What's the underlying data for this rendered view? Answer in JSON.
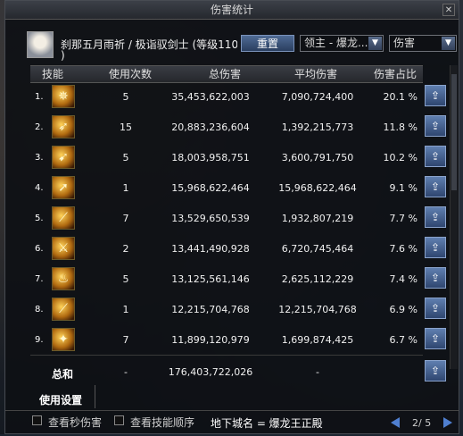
{
  "window": {
    "title": "伤害统计",
    "close_icon": "close-icon"
  },
  "header": {
    "character_name_line1": "刹那五月雨祈 / 极诣驭剑士 (等级110",
    "character_name_line2": ")",
    "reset_button": "重置",
    "target_select": "领主 - 爆龙...",
    "mode_select": "伤害"
  },
  "columns": [
    "技能",
    "使用次数",
    "总伤害",
    "平均伤害",
    "伤害占比"
  ],
  "rows": [
    {
      "index": "1.",
      "uses": "5",
      "total": "35,453,622,003",
      "average": "7,090,724,400",
      "percent": "20.1 %"
    },
    {
      "index": "2.",
      "uses": "15",
      "total": "20,883,236,604",
      "average": "1,392,215,773",
      "percent": "11.8 %"
    },
    {
      "index": "3.",
      "uses": "5",
      "total": "18,003,958,751",
      "average": "3,600,791,750",
      "percent": "10.2 %"
    },
    {
      "index": "4.",
      "uses": "1",
      "total": "15,968,622,464",
      "average": "15,968,622,464",
      "percent": "9.1 %"
    },
    {
      "index": "5.",
      "uses": "7",
      "total": "13,529,650,539",
      "average": "1,932,807,219",
      "percent": "7.7 %"
    },
    {
      "index": "6.",
      "uses": "2",
      "total": "13,441,490,928",
      "average": "6,720,745,464",
      "percent": "7.6 %"
    },
    {
      "index": "7.",
      "uses": "5",
      "total": "13,125,561,146",
      "average": "2,625,112,229",
      "percent": "7.4 %"
    },
    {
      "index": "8.",
      "uses": "1",
      "total": "12,215,704,768",
      "average": "12,215,704,768",
      "percent": "6.9 %"
    },
    {
      "index": "9.",
      "uses": "7",
      "total": "11,899,120,979",
      "average": "1,699,874,425",
      "percent": "6.7 %"
    }
  ],
  "total_row": {
    "label": "总和",
    "uses": "-",
    "total": "176,403,722,026",
    "average": "-"
  },
  "settings": {
    "label": "使用设置"
  },
  "footer": {
    "checkbox1_label": "查看秒伤害",
    "checkbox2_label": "查看技能顺序",
    "dungeon": "地下城名 = 爆龙王正殿",
    "page": "2/ 5"
  }
}
